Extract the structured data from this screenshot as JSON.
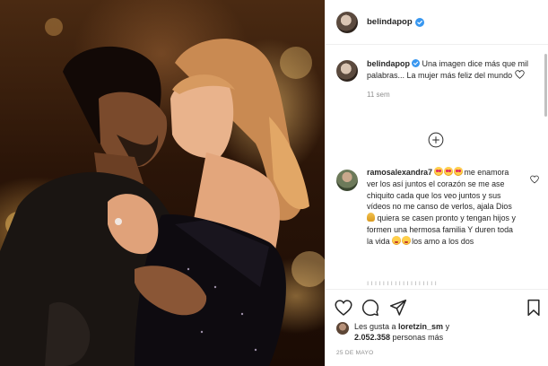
{
  "post": {
    "author": "belindapop",
    "verified": true,
    "caption": {
      "username": "belindapop",
      "text": " Una imagen dice más que mil palabras... La mujer más feliz del mundo ",
      "timestamp": "11 sem"
    },
    "comments": [
      {
        "username": "ramosalexandra7",
        "text_a": "me enamora ver los así juntos el corazón se me ase chiquito cada que los veo juntos y sus vídeos no me canso de verlos, ajala Dios ",
        "text_b": " quiera se casen pronto y tengan hijos y formen una hermosa familia Y duren toda la vida ",
        "text_c": "los amo a los dos"
      }
    ],
    "likes": {
      "prefix": "Les gusta a ",
      "user": "loretzin_sm",
      "middle": " y",
      "count": "2.052.358",
      "suffix": " personas más"
    },
    "date": "25 DE MAYO"
  },
  "icons": {
    "verified": "verified-badge-icon",
    "add_comment": "plus-circle-icon",
    "like": "heart-icon",
    "comment": "comment-bubble-icon",
    "share": "paper-plane-icon",
    "save": "bookmark-icon"
  },
  "colors": {
    "verified_blue": "#3897f0",
    "text": "#262626",
    "muted": "#8e8e8e",
    "border": "#efefef"
  }
}
